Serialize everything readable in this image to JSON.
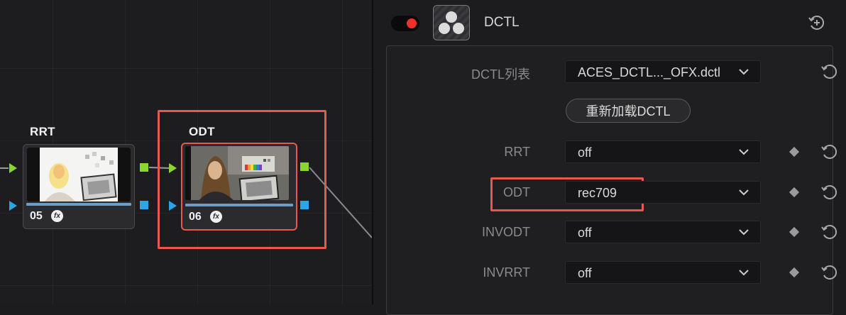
{
  "nodes": [
    {
      "id": "rrt",
      "label": "RRT",
      "number": "05",
      "fx": "fx"
    },
    {
      "id": "odt",
      "label": "ODT",
      "number": "06",
      "fx": "fx"
    }
  ],
  "plugin": {
    "title": "DCTL",
    "enabled": true,
    "icon": "davinci-resolve-logo-icon"
  },
  "controls": {
    "dctl_list": {
      "label": "DCTL列表",
      "value": "ACES_DCTL..._OFX.dctl"
    },
    "reload_button": "重新加载DCTL",
    "rrt": {
      "label": "RRT",
      "value": "off"
    },
    "odt": {
      "label": "ODT",
      "value": "rec709"
    },
    "invodt": {
      "label": "INVODT",
      "value": "off"
    },
    "invrrt": {
      "label": "INVRRT",
      "value": "off"
    }
  },
  "colors": {
    "highlight": "#e8584f",
    "toggle_on": "#f0312a",
    "port_green": "#8ad630",
    "port_blue": "#2aa6e8"
  }
}
